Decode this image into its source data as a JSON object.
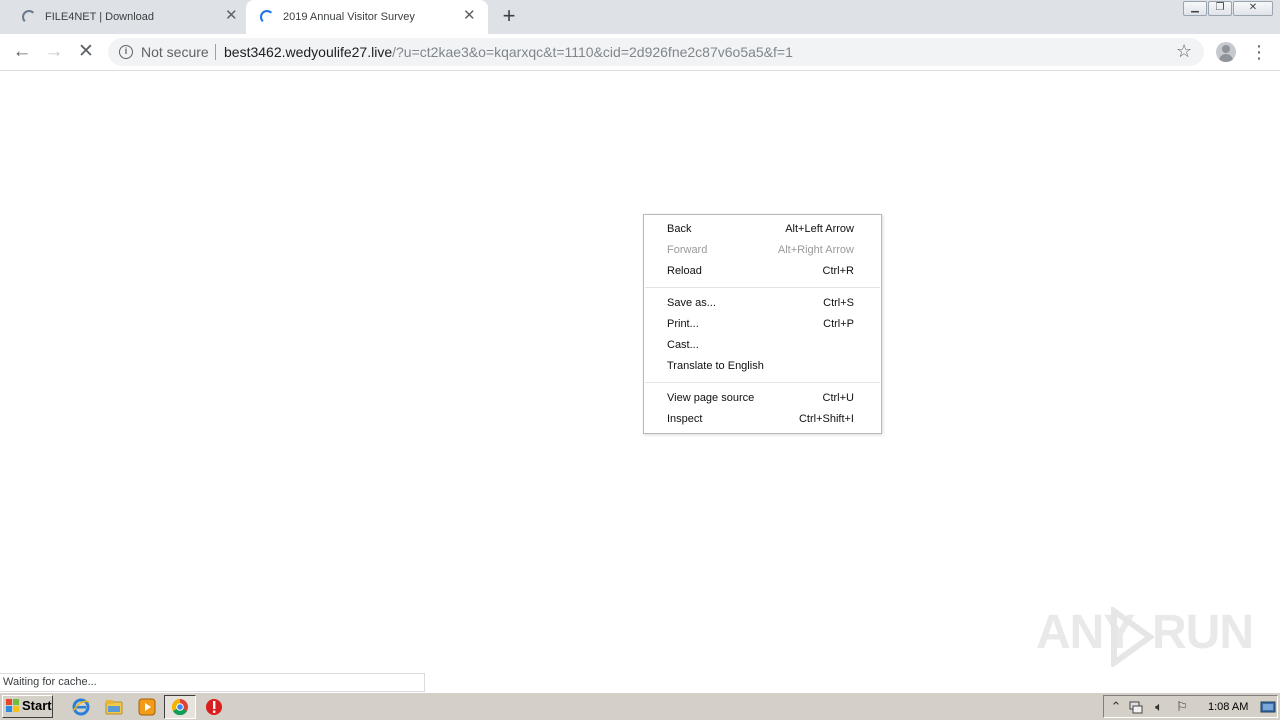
{
  "browser": {
    "tabs": [
      {
        "title": "FILE4NET | Download",
        "loading": true,
        "active": false
      },
      {
        "title": "2019 Annual Visitor Survey",
        "loading": true,
        "active": true
      }
    ],
    "new_tab_label": "+",
    "address_bar": {
      "security_label": "Not secure",
      "url_host": "best3462.wedyoulife27.live",
      "url_rest": "/?u=ct2kae3&o=kqarxqc&t=1110&cid=2d926fne2c87v6o5a5&f=1"
    },
    "status_text": "Waiting for cache..."
  },
  "context_menu": {
    "items": [
      {
        "label": "Back",
        "shortcut": "Alt+Left Arrow",
        "enabled": true
      },
      {
        "label": "Forward",
        "shortcut": "Alt+Right Arrow",
        "enabled": false
      },
      {
        "label": "Reload",
        "shortcut": "Ctrl+R",
        "enabled": true
      },
      {
        "label": "Save as...",
        "shortcut": "Ctrl+S",
        "enabled": true
      },
      {
        "label": "Print...",
        "shortcut": "Ctrl+P",
        "enabled": true
      },
      {
        "label": "Cast...",
        "shortcut": "",
        "enabled": true
      },
      {
        "label": "Translate to English",
        "shortcut": "",
        "enabled": true
      },
      {
        "label": "View page source",
        "shortcut": "Ctrl+U",
        "enabled": true
      },
      {
        "label": "Inspect",
        "shortcut": "Ctrl+Shift+I",
        "enabled": true
      }
    ]
  },
  "watermark": {
    "text_left": "ANY",
    "text_right": "RUN"
  },
  "taskbar": {
    "start_label": "Start",
    "pinned_icons": [
      "internet-explorer-icon",
      "folder-icon",
      "media-player-icon",
      "chrome-icon",
      "stop-sign-icon"
    ],
    "tray_icons": [
      "show-hidden-icon",
      "network-icon",
      "volume-icon",
      "action-center-flag-icon"
    ],
    "clock": "1:08 AM"
  },
  "colors": {
    "tabstrip": "#dee1e6",
    "active_tab": "#ffffff",
    "loading_spinner": "#1a73e8",
    "taskbar": "#d4d0c8"
  }
}
